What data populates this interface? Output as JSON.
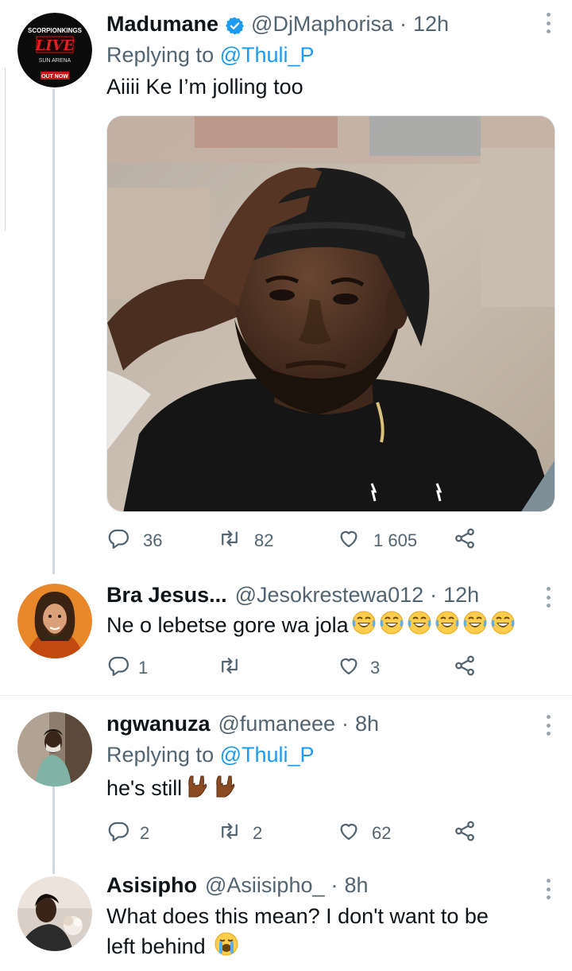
{
  "colors": {
    "link": "#1d9bf0",
    "secondary_text": "#536471",
    "thread_line": "#cfd9de",
    "verified_badge": "#1d9bf0"
  },
  "tweets": [
    {
      "name": "Madumane",
      "handle": "@DjMaphorisa",
      "time": "12h",
      "replying_prefix": "Replying to",
      "replying_to": "@Thuli_P",
      "text": "Aiiii Ke I’m jolling too",
      "avatar_text": {
        "line1": "SCORPIONKINGS",
        "line2": "LIVE",
        "line3": "SUN ARENA",
        "line4": "OUT NOW"
      },
      "counts": {
        "reply": "36",
        "retweet": "82",
        "like": "1 605"
      }
    },
    {
      "name": "Bra Jesus...",
      "handle": "@Jesokrestewa012",
      "time": "12h",
      "text": "Ne o lebetse gore wa jola",
      "emoji": [
        "laughing-emoji",
        "laughing-emoji",
        "laughing-emoji",
        "laughing-emoji",
        "laughing-emoji",
        "laughing-emoji"
      ],
      "counts": {
        "reply": "1",
        "retweet": "",
        "like": "3"
      }
    },
    {
      "name": "ngwanuza",
      "handle": "@fumaneee",
      "time": "8h",
      "replying_prefix": "Replying to",
      "replying_to": "@Thuli_P",
      "text": "he's still",
      "emoji": [
        "rock-hand-emoji",
        "rock-hand-emoji"
      ],
      "counts": {
        "reply": "2",
        "retweet": "2",
        "like": "62"
      }
    },
    {
      "name": "Asisipho",
      "handle": "@Asiisipho_",
      "time": "8h",
      "text_line1": "What does this mean? I don't want to be",
      "text_line2": "left behind",
      "emoji": [
        "crying-emoji"
      ]
    }
  ]
}
